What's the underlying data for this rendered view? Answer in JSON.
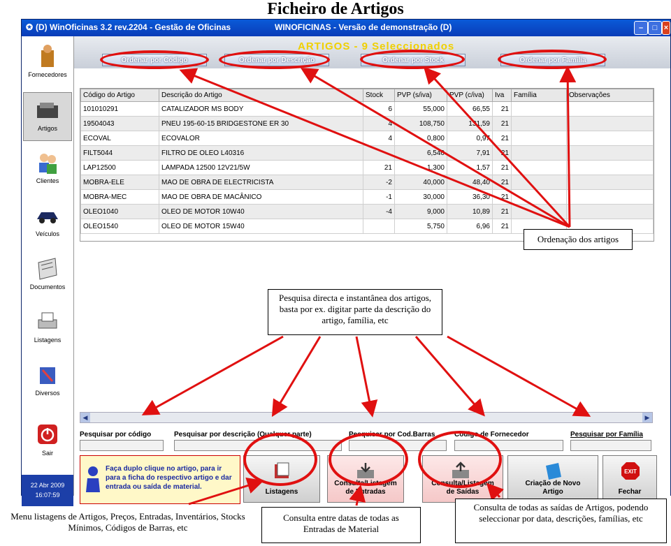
{
  "page_title": "Ficheiro de Artigos",
  "window": {
    "title_left": "(D)  WinOficinas 3.2 rev.2204 - Gestão de Oficinas",
    "title_right": "WINOFICINAS - Versão de demonstração     (D)",
    "banner": "ARTIGOS -  9 Seleccionados"
  },
  "sidebar": {
    "items": [
      {
        "label": "Fornecedores",
        "icon": "supplier-icon"
      },
      {
        "label": "Artigos",
        "icon": "articles-icon"
      },
      {
        "label": "Clientes",
        "icon": "clients-icon"
      },
      {
        "label": "Veículos",
        "icon": "car-icon"
      },
      {
        "label": "Documentos",
        "icon": "documents-icon"
      },
      {
        "label": "Listagens",
        "icon": "printer-icon"
      },
      {
        "label": "Diversos",
        "icon": "tools-icon"
      },
      {
        "label": "Sair",
        "icon": "power-icon"
      }
    ],
    "date": "22 Abr 2009",
    "time": "16:07:59"
  },
  "sort_buttons": {
    "by_code": "Ordenar por Código",
    "by_description": "Ordenar por Descrição",
    "by_stock": "Ordenar por Stock",
    "by_family": "Ordenar por Família"
  },
  "table": {
    "columns": [
      "Código do Artigo",
      "Descrição do Artigo",
      "Stock",
      "PVP (s/iva)",
      "PVP (c/iva)",
      "Iva",
      "Família",
      "Observações"
    ],
    "rows": [
      [
        "101010291",
        "CATALIZADOR MS BODY",
        "6",
        "55,000",
        "66,55",
        "21",
        "",
        ""
      ],
      [
        "19504043",
        "PNEU 195-60-15 BRIDGESTONE ER 30",
        "4",
        "108,750",
        "131,59",
        "21",
        "",
        ""
      ],
      [
        "ECOVAL",
        "ECOVALOR",
        "4",
        "0,800",
        "0,97",
        "21",
        "",
        ""
      ],
      [
        "FILT5044",
        "FILTRO DE OLEO L40316",
        "",
        "6,540",
        "7,91",
        "21",
        "",
        ""
      ],
      [
        "LAP12500",
        "LAMPADA 12500 12V21/5W",
        "21",
        "1,300",
        "1,57",
        "21",
        "",
        ""
      ],
      [
        "MOBRA-ELE",
        "MAO DE OBRA DE ELECTRICISTA",
        "-2",
        "40,000",
        "48,40",
        "21",
        "",
        ""
      ],
      [
        "MOBRA-MEC",
        "MAO DE OBRA DE MACÂNICO",
        "-1",
        "30,000",
        "36,30",
        "21",
        "",
        ""
      ],
      [
        "OLEO1040",
        "OLEO DE MOTOR 10W40",
        "-4",
        "9,000",
        "10,89",
        "21",
        "",
        ""
      ],
      [
        "OLEO1540",
        "OLEO DE MOTOR 15W40",
        "",
        "5,750",
        "6,96",
        "21",
        "",
        ""
      ]
    ]
  },
  "search": {
    "by_code": "Pesquisar por código",
    "by_description": "Pesquisar por descrição (Qualquer parte)",
    "by_barcode": "Pesquisar por Cod.Barras",
    "supplier_code": "Código de Fornecedor",
    "by_family": "Pesquisar por Família"
  },
  "hint": "Faça duplo clique no artigo, para ir para a ficha do respectivo artigo e dar entrada ou saída de material.",
  "action_buttons": {
    "listagens": "Listagens",
    "entradas_l1": "Consulta/Listagem",
    "entradas_l2": "de Entradas",
    "saidas_l1": "Consulta/Listagem",
    "saidas_l2": "de Saídas",
    "novo_l1": "Criação de Novo",
    "novo_l2": "Artigo",
    "exit_badge": "EXIT",
    "fechar": "Fechar"
  },
  "annotations": {
    "ordenacao": "Ordenação dos artigos",
    "pesquisa": "Pesquisa directa e instantânea dos artigos, basta por ex. digitar parte da descrição do artigo, família, etc",
    "menu_listagens": "Menu listagens de Artigos, Preços, Entradas, Inventários, Stocks Mínimos, Códigos de Barras, etc",
    "consulta_entradas": "Consulta entre datas de todas as Entradas de Material",
    "consulta_saidas": "Consulta de todas as saídas de Artigos, podendo seleccionar por data, descrições, famílias, etc"
  },
  "colors": {
    "titlebar": "#0a4cc8",
    "banner": "#f0d000",
    "annotation_red": "#e01010",
    "hint_text": "#1a2aa0"
  }
}
